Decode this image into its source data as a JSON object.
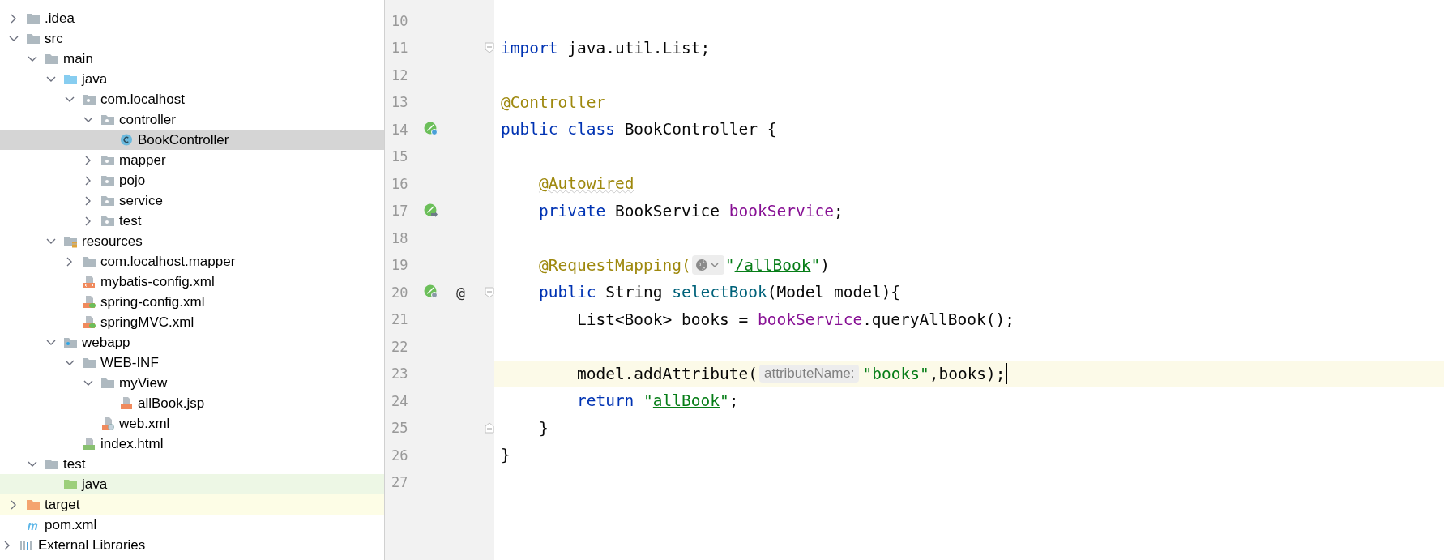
{
  "project_tree": [
    {
      "children": [
        {
          "label": ".idea",
          "kind": "folder",
          "expanded": false,
          "selected": false
        },
        {
          "label": "src",
          "kind": "folder",
          "expanded": true,
          "selected": false,
          "children": [
            {
              "label": "main",
              "kind": "folder",
              "expanded": true,
              "selected": false,
              "children": [
                {
                  "label": "java",
                  "kind": "source-folder",
                  "expanded": true,
                  "selected": false,
                  "children": [
                    {
                      "label": "com.localhost",
                      "kind": "package",
                      "expanded": true,
                      "selected": false,
                      "children": [
                        {
                          "label": "controller",
                          "kind": "package",
                          "expanded": true,
                          "selected": false,
                          "children": [
                            {
                              "label": "BookController",
                              "kind": "class",
                              "selected": true
                            }
                          ]
                        },
                        {
                          "label": "mapper",
                          "kind": "package",
                          "expanded": false,
                          "selected": false
                        },
                        {
                          "label": "pojo",
                          "kind": "package",
                          "expanded": false,
                          "selected": false
                        },
                        {
                          "label": "service",
                          "kind": "package",
                          "expanded": false,
                          "selected": false
                        },
                        {
                          "label": "test",
                          "kind": "package",
                          "expanded": false,
                          "selected": false
                        }
                      ]
                    }
                  ]
                },
                {
                  "label": "resources",
                  "kind": "resources-folder",
                  "expanded": true,
                  "selected": false,
                  "children": [
                    {
                      "label": "com.localhost.mapper",
                      "kind": "folder",
                      "expanded": false,
                      "selected": false
                    },
                    {
                      "label": "mybatis-config.xml",
                      "kind": "xml-file",
                      "selected": false
                    },
                    {
                      "label": "spring-config.xml",
                      "kind": "spring-xml-file",
                      "selected": false
                    },
                    {
                      "label": "springMVC.xml",
                      "kind": "spring-xml-file",
                      "selected": false
                    }
                  ]
                },
                {
                  "label": "webapp",
                  "kind": "web-folder",
                  "expanded": true,
                  "selected": false,
                  "children": [
                    {
                      "label": "WEB-INF",
                      "kind": "folder",
                      "expanded": true,
                      "selected": false,
                      "children": [
                        {
                          "label": "myView",
                          "kind": "folder",
                          "expanded": true,
                          "selected": false,
                          "children": [
                            {
                              "label": "allBook.jsp",
                              "kind": "jsp-file",
                              "selected": false
                            }
                          ]
                        },
                        {
                          "label": "web.xml",
                          "kind": "web-xml-file",
                          "selected": false
                        }
                      ]
                    },
                    {
                      "label": "index.html",
                      "kind": "html-file",
                      "selected": false
                    }
                  ]
                }
              ]
            },
            {
              "label": "test",
              "kind": "folder",
              "expanded": true,
              "selected": false,
              "children": [
                {
                  "label": "java",
                  "kind": "test-folder",
                  "selected": false,
                  "color": "#edf7e5"
                }
              ]
            }
          ]
        },
        {
          "label": "target",
          "kind": "excluded-folder",
          "expanded": false,
          "selected": false,
          "color": "#fdfde6"
        },
        {
          "label": "pom.xml",
          "kind": "maven-file",
          "selected": false
        }
      ]
    },
    {
      "label": "External Libraries",
      "kind": "libraries",
      "expanded": false,
      "selected": false
    }
  ],
  "editor": {
    "lines": [
      {
        "number": "10",
        "current": false
      },
      {
        "number": "11",
        "current": false,
        "fold": {
          "kind": "start"
        },
        "tokens": [
          {
            "kind": "keyword",
            "text": "import"
          },
          {
            "kind": "plain",
            "text": " java.util.List;"
          }
        ]
      },
      {
        "number": "12",
        "current": false
      },
      {
        "number": "13",
        "current": false,
        "tokens": [
          {
            "kind": "annotation",
            "text": "@Controller"
          }
        ]
      },
      {
        "number": "14",
        "current": false,
        "gutter_icon": {
          "kind": "bean-search"
        },
        "tokens": [
          {
            "kind": "keyword",
            "text": "public class"
          },
          {
            "kind": "plain",
            "text": " BookController {"
          }
        ]
      },
      {
        "number": "15",
        "current": false
      },
      {
        "number": "16",
        "current": false,
        "tokens": [
          {
            "kind": "annotation-warn",
            "text": "    @Autowired"
          }
        ]
      },
      {
        "number": "17",
        "current": false,
        "gutter_icon": {
          "kind": "bean-link"
        },
        "tokens": [
          {
            "kind": "keyword",
            "text": "    private"
          },
          {
            "kind": "plain",
            "text": " BookService "
          },
          {
            "kind": "field",
            "text": "bookService"
          },
          {
            "kind": "plain",
            "text": ";"
          }
        ]
      },
      {
        "number": "18",
        "current": false
      },
      {
        "number": "19",
        "current": false,
        "tokens": [
          {
            "kind": "annotation",
            "text": "    @RequestMapping("
          },
          {
            "kind": "globe-inlay"
          },
          {
            "kind": "string",
            "text": "\""
          },
          {
            "kind": "link",
            "text": "/allBook"
          },
          {
            "kind": "string",
            "text": "\""
          },
          {
            "kind": "plain",
            "text": ")"
          }
        ]
      },
      {
        "number": "20",
        "current": false,
        "gutter_icon": {
          "kind": "bean-web"
        },
        "gutter_mark": "@",
        "fold": {
          "kind": "start"
        },
        "tokens": [
          {
            "kind": "keyword",
            "text": "    public"
          },
          {
            "kind": "plain",
            "text": " String "
          },
          {
            "kind": "method",
            "text": "selectBook"
          },
          {
            "kind": "plain",
            "text": "(Model model){"
          }
        ]
      },
      {
        "number": "21",
        "current": false,
        "tokens": [
          {
            "kind": "plain",
            "text": "        List<Book> books = "
          },
          {
            "kind": "field",
            "text": "bookService"
          },
          {
            "kind": "plain",
            "text": ".queryAllBook();"
          }
        ]
      },
      {
        "number": "22",
        "current": false
      },
      {
        "number": "23",
        "current": true,
        "tokens": [
          {
            "kind": "plain",
            "text": "        model.addAttribute("
          },
          {
            "kind": "hint",
            "text": "attributeName:"
          },
          {
            "kind": "string",
            "text": "\"books\""
          },
          {
            "kind": "plain",
            "text": ",books);"
          }
        ]
      },
      {
        "number": "24",
        "current": false,
        "tokens": [
          {
            "kind": "keyword",
            "text": "        return "
          },
          {
            "kind": "string",
            "text": "\""
          },
          {
            "kind": "link",
            "text": "allBook"
          },
          {
            "kind": "string",
            "text": "\""
          },
          {
            "kind": "plain",
            "text": ";"
          }
        ]
      },
      {
        "number": "25",
        "current": false,
        "fold": {
          "kind": "end"
        },
        "tokens": [
          {
            "kind": "plain",
            "text": "    }"
          }
        ]
      },
      {
        "number": "26",
        "current": false,
        "tokens": [
          {
            "kind": "plain",
            "text": "}"
          }
        ]
      },
      {
        "number": "27",
        "current": false
      }
    ]
  }
}
